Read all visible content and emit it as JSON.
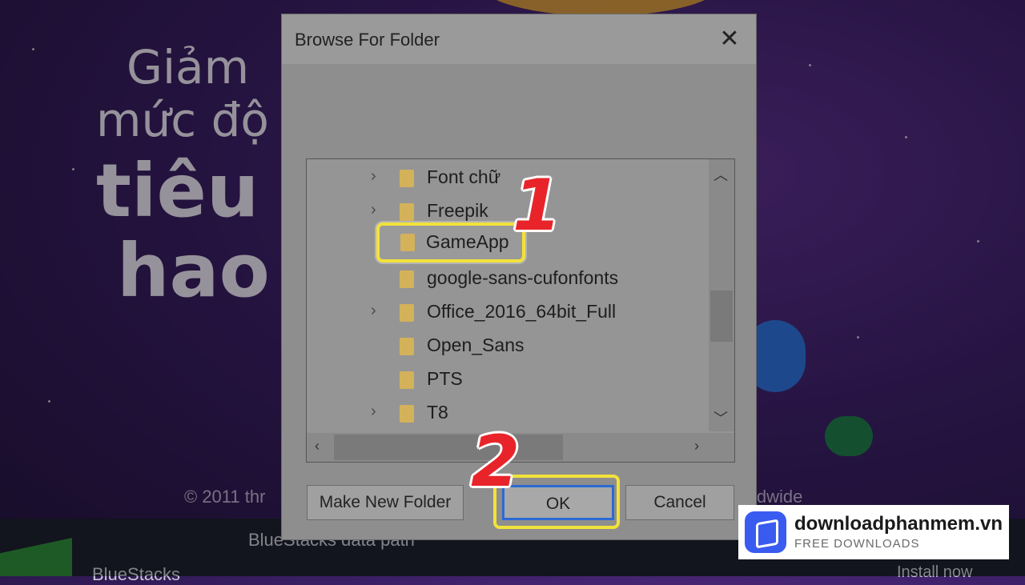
{
  "background": {
    "promo_lines": [
      "Giảm",
      "mức độ",
      "tiêu",
      "hao"
    ],
    "copyright": "© 2011 thr",
    "worldwide": "ldwide",
    "data_path": "BlueStacks data path",
    "brand": "BlueStacks",
    "install": "Install now"
  },
  "dialog": {
    "title": "Browse For Folder",
    "close_glyph": "✕",
    "folders": [
      {
        "name": "Font chữ",
        "expandable": true
      },
      {
        "name": "Freepik",
        "expandable": true
      },
      {
        "name": "GameApp",
        "expandable": false,
        "selected": true
      },
      {
        "name": "google-sans-cufonfonts",
        "expandable": false
      },
      {
        "name": "Office_2016_64bit_Full",
        "expandable": true
      },
      {
        "name": "Open_Sans",
        "expandable": false
      },
      {
        "name": "PTS",
        "expandable": false
      },
      {
        "name": "T8",
        "expandable": true
      }
    ],
    "buttons": {
      "make_new_folder": "Make New Folder",
      "ok": "OK",
      "cancel": "Cancel"
    }
  },
  "annotations": {
    "step1": "1",
    "step2": "2"
  },
  "watermark": {
    "name": "downloadphanmem.vn",
    "tagline": "FREE DOWNLOADS"
  },
  "colors": {
    "highlight": "#f2e23a",
    "marker_red": "#e8242a",
    "ok_focus_border": "#2b6ad3",
    "watermark_accent": "#3a5bf0"
  },
  "icons": [
    "folder-icon",
    "chevron-right-icon",
    "close-icon",
    "scroll-up-icon",
    "scroll-down-icon",
    "scroll-left-icon",
    "scroll-right-icon"
  ]
}
